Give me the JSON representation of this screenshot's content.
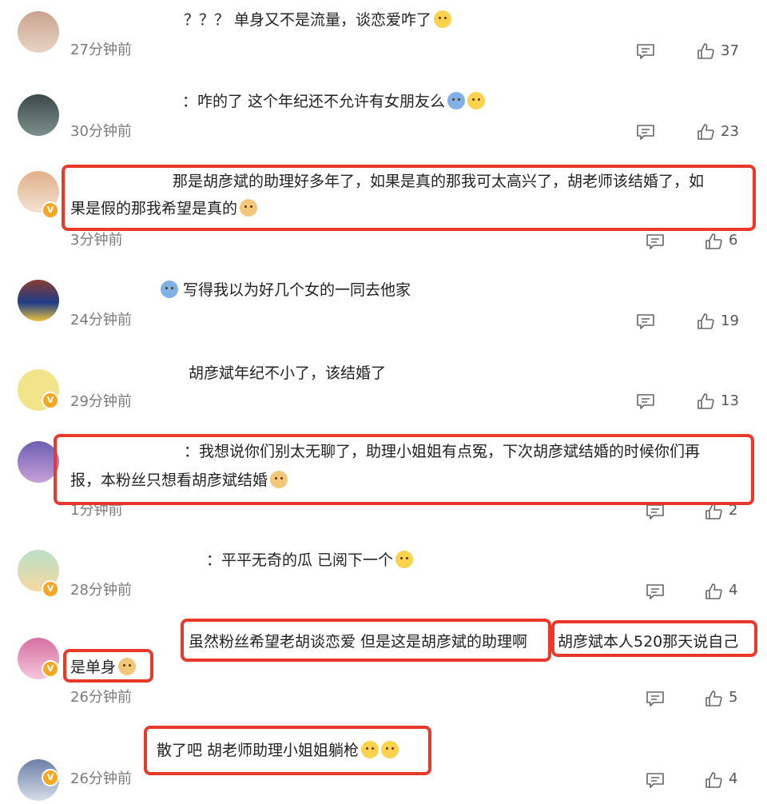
{
  "comments": [
    {
      "text": "？？？ 单身又不是流量，谈恋爱咋了",
      "time": "27分钟前",
      "likes": "37"
    },
    {
      "text": "：咋的了 这个年纪还不允许有女朋友么",
      "time": "30分钟前",
      "likes": "23"
    },
    {
      "text_line1": "那是胡彦斌的助理好多年了，如果是真的那我可太高兴了，胡老师该结婚了，如",
      "text_line2": "果是假的那我希望是真的",
      "time": "3分钟前",
      "likes": "6"
    },
    {
      "text": "写得我以为好几个女的一同去他家",
      "time": "24分钟前",
      "likes": "19"
    },
    {
      "text": "胡彦斌年纪不小了，该结婚了",
      "time": "29分钟前",
      "likes": "13"
    },
    {
      "text_line1": "：我想说你们别太无聊了，助理小姐姐有点冤，下次胡彦斌结婚的时候你们再",
      "text_line2": "报，本粉丝只想看胡彦斌结婚",
      "time": "1分钟前",
      "likes": "2"
    },
    {
      "text": "：平平无奇的瓜 已阅下一个",
      "time": "28分钟前",
      "likes": "4"
    },
    {
      "text_part1": "虽然粉丝希望老胡谈恋爱 但是这是胡彦斌的助理啊",
      "text_part2": "胡彦斌本人520那天说自己",
      "text_line2": "是单身",
      "time": "26分钟前",
      "likes": "5"
    },
    {
      "text": "散了吧 胡老师助理小姐姐躺枪",
      "time": "26分钟前",
      "likes": "4"
    }
  ],
  "icons": {
    "reply": "comment-icon",
    "like": "thumbs-up-icon",
    "verified": "v-badge-icon"
  },
  "colors": {
    "highlight": "#e8392a",
    "time": "#7a7a7a",
    "verified": "#f5a623"
  }
}
